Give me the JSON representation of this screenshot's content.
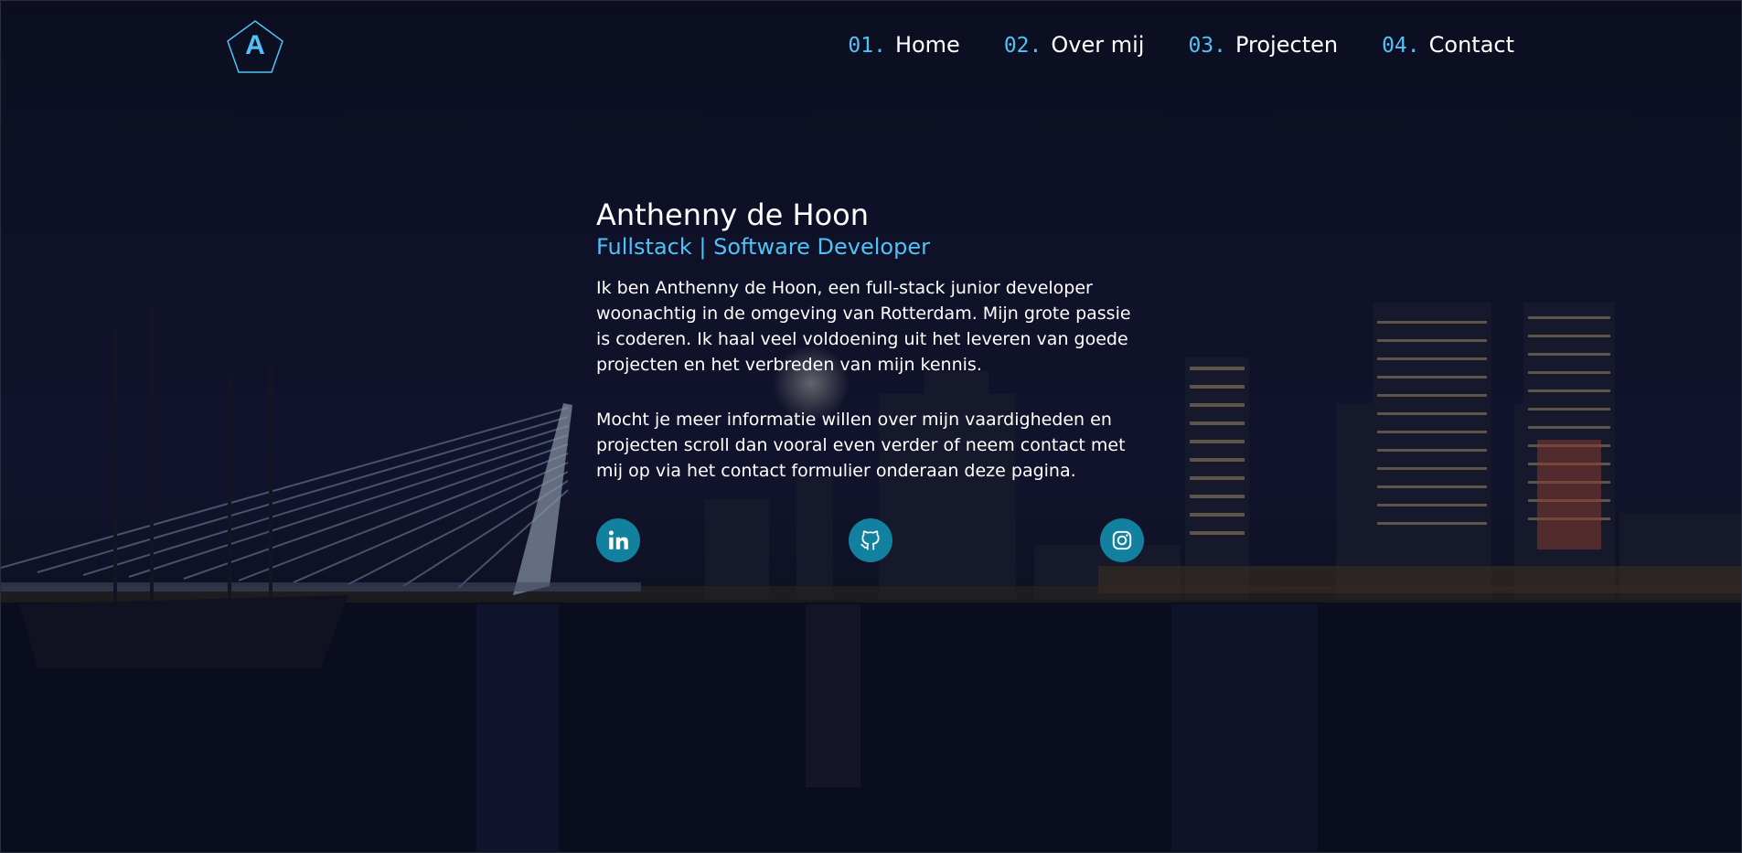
{
  "logo": {
    "letter": "A"
  },
  "nav": {
    "items": [
      {
        "num": "01.",
        "label": "Home"
      },
      {
        "num": "02.",
        "label": "Over mij"
      },
      {
        "num": "03.",
        "label": "Projecten"
      },
      {
        "num": "04.",
        "label": "Contact"
      }
    ]
  },
  "hero": {
    "name": "Anthenny de Hoon",
    "role": "Fullstack | Software Developer",
    "paragraph_1": "Ik ben Anthenny de Hoon, een full-stack junior developer woonachtig in de omgeving van Rotterdam. Mijn grote passie is coderen. Ik haal veel voldoening uit het leveren van goede projecten en het verbreden van mijn kennis.",
    "paragraph_2": "Mocht je meer informatie willen over mijn vaardigheden en projecten scroll dan vooral even verder of neem contact met mij op via het contact formulier onderaan deze pagina."
  },
  "socials": [
    {
      "icon": "linkedin-icon"
    },
    {
      "icon": "github-icon"
    },
    {
      "icon": "instagram-icon"
    }
  ],
  "colors": {
    "accent": "#4fc3f7",
    "social_bg": "#12809f",
    "text": "#ffffff"
  }
}
